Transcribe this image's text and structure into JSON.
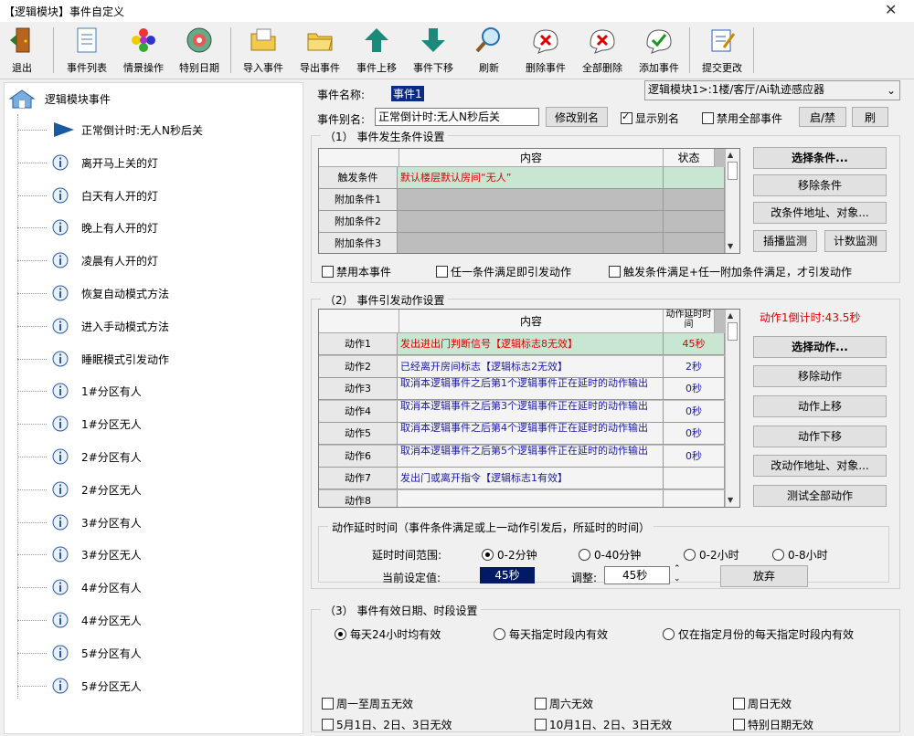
{
  "window": {
    "title": "【逻辑模块】事件自定义",
    "close": "✕"
  },
  "toolbar": [
    {
      "label": "退出",
      "icon": "exit-door-icon"
    },
    {
      "label": "事件列表",
      "icon": "document-list-icon"
    },
    {
      "label": "情景操作",
      "icon": "scene-flower-icon"
    },
    {
      "label": "特别日期",
      "icon": "calendar-disc-icon"
    },
    {
      "label": "导入事件",
      "icon": "import-folder-icon"
    },
    {
      "label": "导出事件",
      "icon": "export-folder-icon"
    },
    {
      "label": "事件上移",
      "icon": "arrow-up-icon"
    },
    {
      "label": "事件下移",
      "icon": "arrow-down-icon"
    },
    {
      "label": "刷新",
      "icon": "magnifier-icon"
    },
    {
      "label": "删除事件",
      "icon": "delete-x-icon"
    },
    {
      "label": "全部删除",
      "icon": "delete-all-icon"
    },
    {
      "label": "添加事件",
      "icon": "add-check-icon"
    },
    {
      "label": "提交更改",
      "icon": "submit-edit-icon"
    }
  ],
  "tree": {
    "root": "逻辑模块事件",
    "items": [
      "正常倒计时:无人N秒后关",
      "离开马上关的灯",
      "白天有人开的灯",
      "晚上有人开的灯",
      "凌晨有人开的灯",
      "恢复自动模式方法",
      "进入手动模式方法",
      "睡眠模式引发动作",
      "1#分区有人",
      "1#分区无人",
      "2#分区有人",
      "2#分区无人",
      "3#分区有人",
      "3#分区无人",
      "4#分区有人",
      "4#分区无人",
      "5#分区有人",
      "5#分区无人"
    ]
  },
  "event": {
    "name_label": "事件名称:",
    "name_value": "事件1",
    "module_select": "逻辑模块1>:1楼/客厅/Ai轨迹感应器",
    "alias_label": "事件别名:",
    "alias_value": "正常倒计时:无人N秒后关",
    "rename_btn": "修改别名",
    "show_alias": "显示别名",
    "disable_all": "禁用全部事件",
    "toggle_btn": "启/禁",
    "refresh_btn": "刷"
  },
  "conditions": {
    "title": "（1） 事件发生条件设置",
    "col_content": "内容",
    "col_status": "状态",
    "rows": [
      {
        "label": "触发条件",
        "content": "默认楼层默认房间“无人”"
      },
      {
        "label": "附加条件1",
        "content": ""
      },
      {
        "label": "附加条件2",
        "content": ""
      },
      {
        "label": "附加条件3",
        "content": ""
      }
    ],
    "buttons": [
      "选择条件...",
      "移除条件",
      "改条件地址、对象...",
      "插播监测",
      "计数监测"
    ],
    "chk_disable": "禁用本事件",
    "chk_any": "任一条件满足即引发动作",
    "chk_trigger_any": "触发条件满足+任一附加条件满足，才引发动作"
  },
  "actions": {
    "title": "（2） 事件引发动作设置",
    "col_content": "内容",
    "col_delay": "动作延时时间",
    "countdown": "动作1倒计时:43.5秒",
    "rows": [
      {
        "label": "动作1",
        "content": "发出进出门判断信号【逻辑标志8无效】",
        "delay": "45秒"
      },
      {
        "label": "动作2",
        "content": "已经离开房间标志【逻辑标志2无效】",
        "delay": "2秒"
      },
      {
        "label": "动作3",
        "content": "取消本逻辑事件之后第1个逻辑事件正在延时的动作输出",
        "delay": "0秒"
      },
      {
        "label": "动作4",
        "content": "取消本逻辑事件之后第3个逻辑事件正在延时的动作输出",
        "delay": "0秒"
      },
      {
        "label": "动作5",
        "content": "取消本逻辑事件之后第4个逻辑事件正在延时的动作输出",
        "delay": "0秒"
      },
      {
        "label": "动作6",
        "content": "取消本逻辑事件之后第5个逻辑事件正在延时的动作输出",
        "delay": "0秒"
      },
      {
        "label": "动作7",
        "content": "发出门或离开指令【逻辑标志1有效】",
        "delay": ""
      },
      {
        "label": "动作8",
        "content": "",
        "delay": ""
      }
    ],
    "buttons": [
      "选择动作...",
      "移除动作",
      "动作上移",
      "动作下移",
      "改动作地址、对象...",
      "测试全部动作"
    ]
  },
  "delay": {
    "title": "动作延时时间（事件条件满足或上一动作引发后，所延时的时间）",
    "range_label": "延时时间范围:",
    "ranges": [
      "0-2分钟",
      "0-40分钟",
      "0-2小时",
      "0-8小时"
    ],
    "current_label": "当前设定值:",
    "current_value": "45秒",
    "adjust_label": "调整:",
    "adjust_value": "45秒",
    "discard_btn": "放弃"
  },
  "validity": {
    "title": "（3） 事件有效日期、时段设置",
    "options": [
      "每天24小时均有效",
      "每天指定时段内有效",
      "仅在指定月份的每天指定时段内有效"
    ],
    "checks": [
      "周一至周五无效",
      "周六无效",
      "周日无效",
      "5月1日、2日、3日无效",
      "10月1日、2日、3日无效",
      "特别日期无效"
    ]
  },
  "colors": {
    "highlight_row": "#c8e6d2",
    "red_text": "#e00000",
    "blue_text": "#1a1aa0",
    "navy": "#001a66"
  }
}
